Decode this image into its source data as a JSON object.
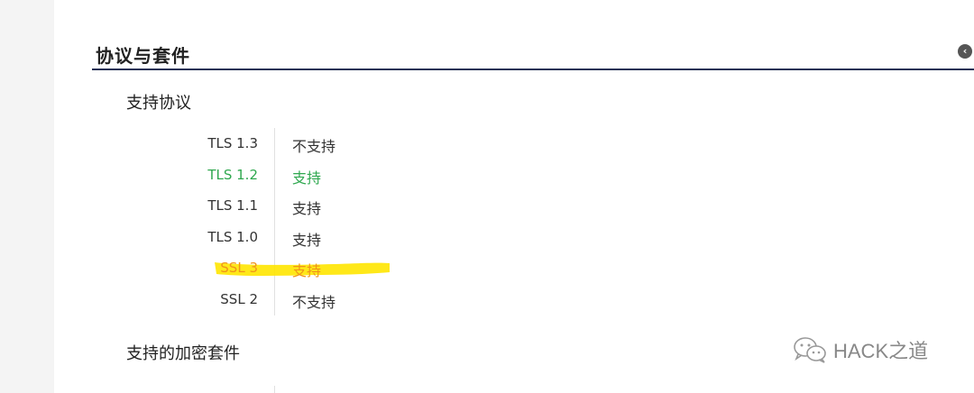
{
  "section": {
    "title": "协议与套件"
  },
  "protocols": {
    "title": "支持协议",
    "rows": [
      {
        "name": "TLS 1.3",
        "status": "不支持"
      },
      {
        "name": "TLS 1.2",
        "status": "支持"
      },
      {
        "name": "TLS 1.1",
        "status": "支持"
      },
      {
        "name": "TLS 1.0",
        "status": "支持"
      },
      {
        "name": "SSL 3",
        "status": "支持"
      },
      {
        "name": "SSL 2",
        "status": "不支持"
      }
    ]
  },
  "cipher_suites": {
    "title": "支持的加密套件"
  },
  "watermark": {
    "text": "HACK之道",
    "icon": "wechat-icon"
  },
  "colors": {
    "header_rule": "#243156",
    "supported_green": "#2fa84f",
    "warning_orange": "#f0941b",
    "highlighter": "#ffe600"
  }
}
